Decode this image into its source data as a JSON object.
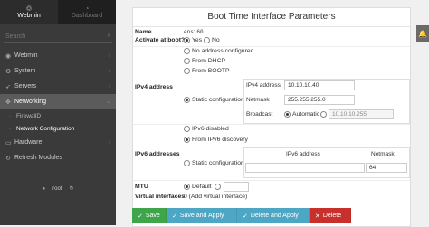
{
  "sidebar": {
    "tabs": [
      {
        "label": "Webmin",
        "icon": "webmin-logo-icon"
      },
      {
        "label": "Dashboard",
        "icon": "dashboard-icon"
      }
    ],
    "search_placeholder": "Search",
    "items": [
      {
        "label": "Webmin",
        "icon": "webmin-icon"
      },
      {
        "label": "System",
        "icon": "gear-icon"
      },
      {
        "label": "Servers",
        "icon": "rocket-icon"
      },
      {
        "label": "Networking",
        "icon": "network-icon"
      },
      {
        "label": "Hardware",
        "icon": "hardware-icon"
      },
      {
        "label": "Refresh Modules",
        "icon": "refresh-icon"
      }
    ],
    "subitems": [
      "FirewallD",
      "Network Configuration"
    ],
    "footer_user": "root"
  },
  "form": {
    "title": "Boot Time Interface Parameters",
    "name_label": "Name",
    "name_value": "ens160",
    "active_label": "Activate at boot?",
    "active_yes": "Yes",
    "active_no": "No",
    "ipv4_label": "IPv4 address",
    "ipv4_opt_none": "No address configured",
    "ipv4_opt_dhcp": "From DHCP",
    "ipv4_opt_bootp": "From BOOTP",
    "ipv4_opt_static": "Static configuration",
    "ipv4_addr_label": "IPv4 address",
    "ipv4_addr_value": "10.10.10.40",
    "netmask_label": "Netmask",
    "netmask_value": "255.255.255.0",
    "broadcast_label": "Broadcast",
    "broadcast_auto": "Automatic",
    "broadcast_value": "10.10.10.255",
    "ipv6_label": "IPv6 addresses",
    "ipv6_opt_disabled": "IPv6 disabled",
    "ipv6_opt_discovery": "From IPv6 discovery",
    "ipv6_opt_static": "Static configuration",
    "ipv6_col_address": "IPv6 address",
    "ipv6_col_netmask": "Netmask",
    "ipv6_netmask_value": "64",
    "mtu_label": "MTU",
    "mtu_default": "Default",
    "virtual_label": "Virtual interfaces",
    "virtual_value": "0 (Add virtual interface)"
  },
  "buttons": {
    "save": "Save",
    "save_apply": "Save and Apply",
    "delete_apply": "Delete and Apply",
    "delete": "Delete"
  },
  "colors": {
    "save": "#3fa54a",
    "apply": "#4da7c4",
    "delete": "#c9302c",
    "sidebar": "#3a3a3a"
  }
}
